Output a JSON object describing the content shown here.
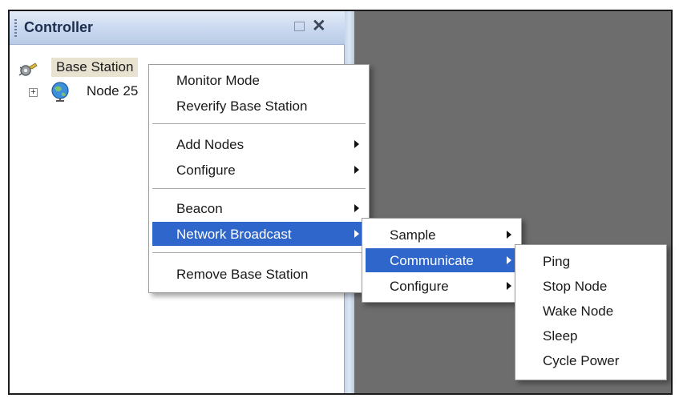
{
  "panel": {
    "title": "Controller",
    "tree": {
      "base_station_label": "Base Station",
      "node_label": "Node 25",
      "expander_symbol": "+"
    }
  },
  "context_menu": {
    "items": [
      {
        "label": "Monitor Mode"
      },
      {
        "label": "Reverify Base Station"
      },
      {
        "label": "Add Nodes"
      },
      {
        "label": "Configure"
      },
      {
        "label": "Beacon"
      },
      {
        "label": "Network Broadcast"
      },
      {
        "label": "Remove Base Station"
      }
    ]
  },
  "broadcast_submenu": {
    "items": [
      {
        "label": "Sample"
      },
      {
        "label": "Communicate"
      },
      {
        "label": "Configure"
      }
    ]
  },
  "communicate_submenu": {
    "items": [
      {
        "label": "Ping"
      },
      {
        "label": "Stop Node"
      },
      {
        "label": "Wake Node"
      },
      {
        "label": "Sleep"
      },
      {
        "label": "Cycle Power"
      }
    ]
  },
  "colors": {
    "highlight": "#2f66cc",
    "workspace": "#6d6d6d",
    "titlebar": "#c9d8ef"
  }
}
